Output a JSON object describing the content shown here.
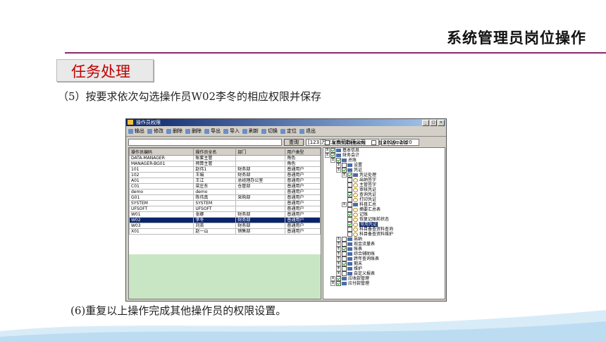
{
  "slide": {
    "header_title": "系统管理员岗位操作",
    "task_label": "任务处理",
    "step5": "（5）按要求依次勾选操作员W02李冬的相应权限并保存",
    "step6": "(6)重复以上操作完成其他操作员的权限设置。"
  },
  "window": {
    "title": "操作员权限",
    "toolbar": [
      "输出",
      "修改",
      "删除",
      "删除",
      "导出",
      "导入",
      "刷新",
      "切换",
      "定位",
      "退出"
    ],
    "query_button": "查询",
    "account_select": "[123]万兴发商贸有限公司",
    "year_select": "2020--2020",
    "option_show_role": "显示所属角色权限",
    "option_show_selected": "仅显示选中条目",
    "columns": [
      "操作员编码",
      "操作员全名",
      "部门",
      "用户类型"
    ],
    "rows": [
      [
        "DATA-MANAGER",
        "账套主管",
        "",
        "角色"
      ],
      [
        "MANAGER-BG01",
        "预算主管",
        "",
        "角色"
      ],
      [
        "101",
        "赵伟1",
        "财务部",
        "普通用户"
      ],
      [
        "102",
        "王娟",
        "财务部",
        "普通用户"
      ],
      [
        "A01",
        "王江",
        "总经理办公室",
        "普通用户"
      ],
      [
        "C01",
        "梁庄东",
        "仓管部",
        "普通用户"
      ],
      [
        "demo",
        "demo",
        "",
        "普通用户"
      ],
      [
        "G01",
        "陈伟真",
        "采购部",
        "普通用户"
      ],
      [
        "SYSTEM",
        "SYSTEM",
        "",
        "普通用户"
      ],
      [
        "UFSOFT",
        "UFSOFT",
        "",
        "普通用户"
      ],
      [
        "W01",
        "张娜",
        "财务部",
        "普通用户"
      ],
      [
        "W02",
        "李冬",
        "财务部",
        "普通用户"
      ],
      [
        "W03",
        "刘英",
        "财务部",
        "普通用户"
      ],
      [
        "X01",
        "赵一山",
        "销售部",
        "普通用户"
      ]
    ],
    "tree": [
      {
        "label": "基本信息",
        "level": 0,
        "checked": true,
        "type": "folder"
      },
      {
        "label": "财务会计",
        "level": 0,
        "checked": true,
        "type": "folder"
      },
      {
        "label": "总账",
        "level": 1,
        "checked": true,
        "type": "folder"
      },
      {
        "label": "设置",
        "level": 2,
        "checked": false,
        "type": "folder"
      },
      {
        "label": "凭证",
        "level": 2,
        "checked": true,
        "type": "folder"
      },
      {
        "label": "凭证处理",
        "level": 3,
        "checked": true,
        "type": "folder"
      },
      {
        "label": "出纳签字",
        "level": 4,
        "checked": false,
        "type": "key"
      },
      {
        "label": "主管签字",
        "level": 4,
        "checked": false,
        "type": "key"
      },
      {
        "label": "审核凭证",
        "level": 4,
        "checked": false,
        "type": "key"
      },
      {
        "label": "查询凭证",
        "level": 4,
        "checked": true,
        "type": "key"
      },
      {
        "label": "打印凭证",
        "level": 4,
        "checked": false,
        "type": "key"
      },
      {
        "label": "科目汇总",
        "level": 3,
        "checked": false,
        "type": "folder"
      },
      {
        "label": "摘要汇总表",
        "level": 4,
        "checked": false,
        "type": "key"
      },
      {
        "label": "记账",
        "level": 4,
        "checked": true,
        "type": "key"
      },
      {
        "label": "恢复记账前状态",
        "level": 4,
        "checked": false,
        "type": "key"
      },
      {
        "label": "常用凭证",
        "level": 4,
        "checked": true,
        "type": "key",
        "highlight": true
      },
      {
        "label": "科目备查资料查询",
        "level": 4,
        "checked": false,
        "type": "key"
      },
      {
        "label": "科目备查资料维护",
        "level": 4,
        "checked": false,
        "type": "key"
      },
      {
        "label": "出纳",
        "level": 2,
        "checked": false,
        "type": "folder"
      },
      {
        "label": "现金流量表",
        "level": 2,
        "checked": false,
        "type": "folder"
      },
      {
        "label": "账表",
        "level": 2,
        "checked": true,
        "type": "folder"
      },
      {
        "label": "综合辅助账",
        "level": 2,
        "checked": false,
        "type": "folder"
      },
      {
        "label": "跨年查询账表",
        "level": 2,
        "checked": false,
        "type": "folder"
      },
      {
        "label": "期末",
        "level": 2,
        "checked": true,
        "type": "folder"
      },
      {
        "label": "维护",
        "level": 2,
        "checked": false,
        "type": "folder"
      },
      {
        "label": "自定义报表",
        "level": 2,
        "checked": false,
        "type": "folder"
      },
      {
        "label": "应收款管理",
        "level": 1,
        "checked": true,
        "type": "folder"
      },
      {
        "label": "应付款管理",
        "level": 1,
        "checked": true,
        "type": "folder"
      }
    ]
  }
}
